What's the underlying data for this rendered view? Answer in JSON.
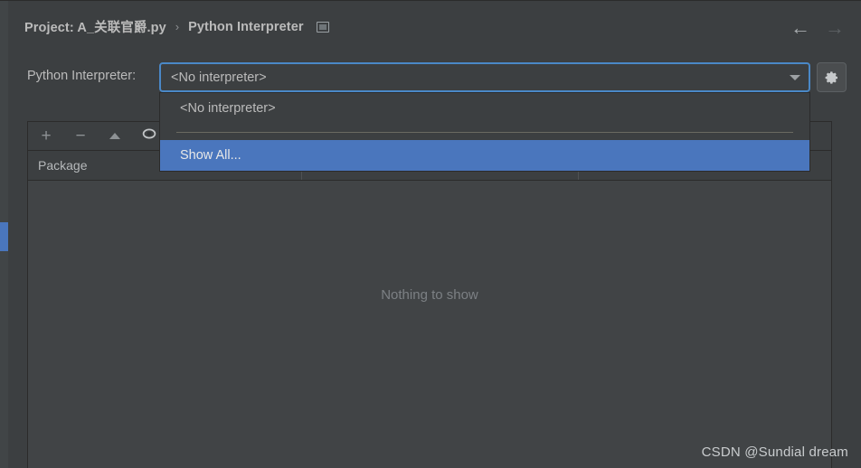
{
  "window": {
    "background_color": "#3c3f41",
    "accent_color": "#4a76bd",
    "focus_border_color": "#4a88c7"
  },
  "breadcrumb": {
    "project_crumb": "Project: A_关联官爵.py",
    "separator": "›",
    "page_crumb": "Python Interpreter",
    "icon": "window-icon"
  },
  "nav": {
    "back_icon": "←",
    "back_name": "back-arrow-icon",
    "forward_icon": "→",
    "forward_name": "forward-arrow-icon",
    "forward_disabled": true
  },
  "interpreter": {
    "label": "Python Interpreter:",
    "selected_value": "<No interpreter>",
    "dropdown_open": true,
    "dropdown_arrow_icon": "chevron-down-icon",
    "settings_icon": "gear-icon"
  },
  "dropdown": {
    "items": [
      {
        "label": "<No interpreter>",
        "selected": false
      },
      {
        "label": "Show All...",
        "selected": true
      }
    ],
    "separator_after_index": 0
  },
  "packages": {
    "toolbar": [
      {
        "name": "add-package-button",
        "glyph": "+",
        "title": "Install"
      },
      {
        "name": "remove-package-button",
        "glyph": "−",
        "title": "Uninstall"
      },
      {
        "name": "upgrade-package-button",
        "glyph": "▲",
        "title": "Upgrade"
      },
      {
        "name": "show-early-releases-button",
        "glyph": "eye",
        "title": "Show Early Releases"
      }
    ],
    "columns": [
      "Package",
      "",
      ""
    ],
    "rows": [],
    "empty_message": "Nothing to show"
  },
  "watermark": {
    "text": "CSDN @Sundial dream"
  }
}
